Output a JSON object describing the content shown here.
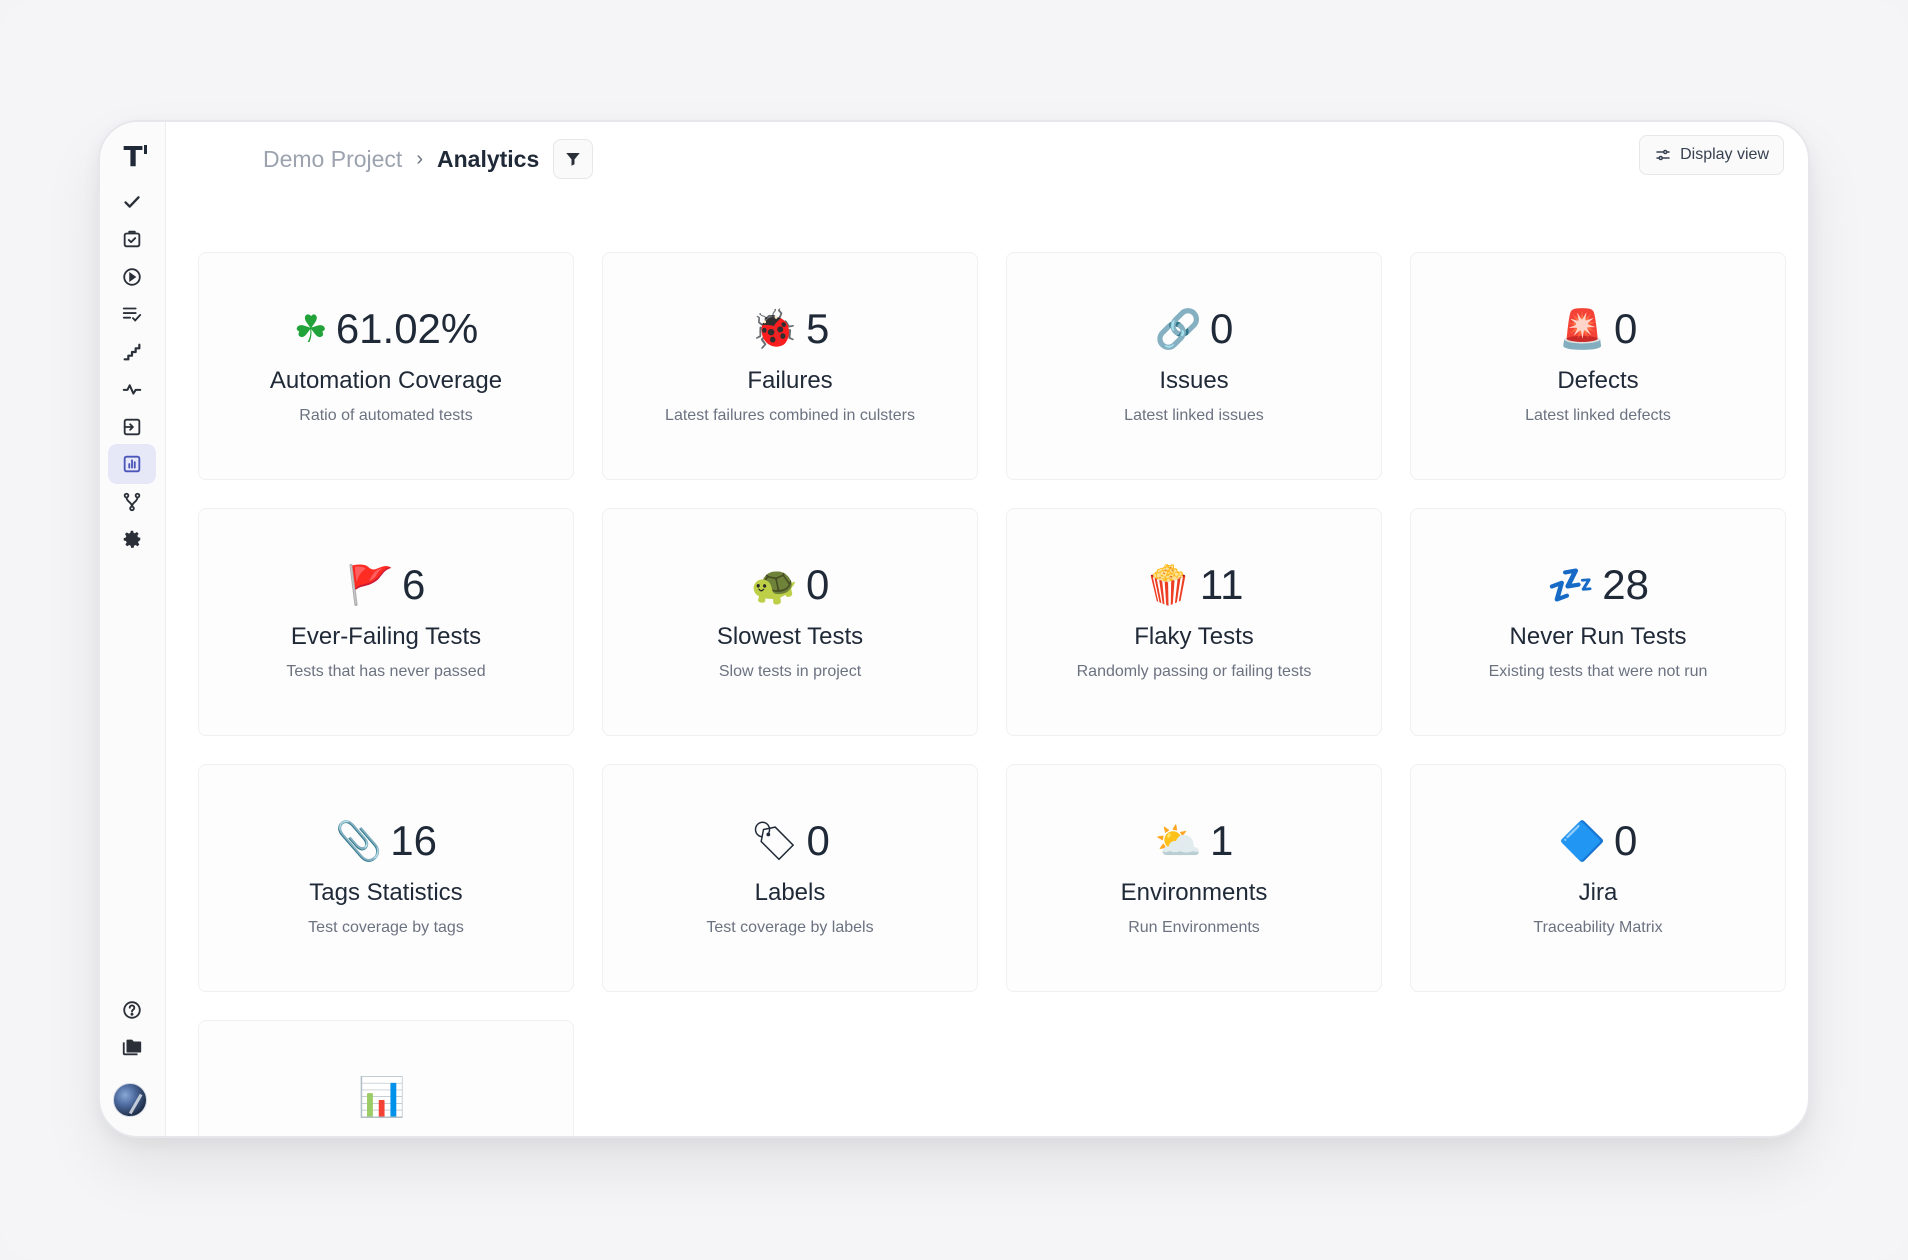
{
  "breadcrumb": {
    "project": "Demo Project",
    "separator": "›",
    "current": "Analytics"
  },
  "header": {
    "display_view_label": "Display view"
  },
  "sidebar": {
    "logo": "T",
    "items": [
      {
        "name": "check-icon"
      },
      {
        "name": "clipboard-check-icon"
      },
      {
        "name": "play-circle-icon"
      },
      {
        "name": "list-check-icon"
      },
      {
        "name": "steps-icon"
      },
      {
        "name": "pulse-icon"
      },
      {
        "name": "import-icon"
      },
      {
        "name": "bar-chart-icon",
        "active": true
      },
      {
        "name": "branch-icon"
      },
      {
        "name": "gear-icon"
      }
    ],
    "bottom": [
      {
        "name": "help-icon"
      },
      {
        "name": "folders-icon"
      }
    ]
  },
  "cards": [
    {
      "emoji": "☘",
      "value": "61.02%",
      "title": "Automation Coverage",
      "subtitle": "Ratio of automated tests"
    },
    {
      "emoji": "🐞",
      "value": "5",
      "title": "Failures",
      "subtitle": "Latest failures combined in culsters"
    },
    {
      "emoji": "🔗",
      "value": "0",
      "title": "Issues",
      "subtitle": "Latest linked issues"
    },
    {
      "emoji": "🚨",
      "value": "0",
      "title": "Defects",
      "subtitle": "Latest linked defects"
    },
    {
      "emoji": "🚩",
      "value": "6",
      "title": "Ever-Failing Tests",
      "subtitle": "Tests that has never passed"
    },
    {
      "emoji": "🐢",
      "value": "0",
      "title": "Slowest Tests",
      "subtitle": "Slow tests in project"
    },
    {
      "emoji": "🍿",
      "value": "11",
      "title": "Flaky Tests",
      "subtitle": "Randomly passing or failing tests"
    },
    {
      "emoji": "💤",
      "value": "28",
      "title": "Never Run Tests",
      "subtitle": "Existing tests that were not run"
    },
    {
      "emoji": "📎",
      "value": "16",
      "title": "Tags Statistics",
      "subtitle": "Test coverage by tags"
    },
    {
      "emoji": "🏷",
      "value": "0",
      "title": "Labels",
      "subtitle": "Test coverage by labels"
    },
    {
      "emoji": "⛅",
      "value": "1",
      "title": "Environments",
      "subtitle": "Run Environments"
    },
    {
      "emoji": "🔷",
      "value": "0",
      "title": "Jira",
      "subtitle": "Traceability Matrix"
    },
    {
      "emoji": "📊",
      "value": "",
      "title": "",
      "subtitle": ""
    }
  ]
}
